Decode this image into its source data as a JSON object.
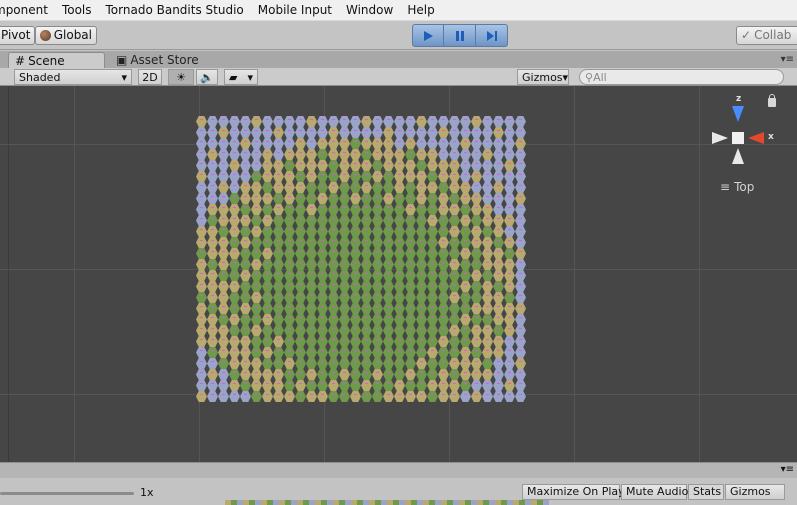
{
  "menu": [
    "mponent",
    "Tools",
    "Tornado Bandits Studio",
    "Mobile Input",
    "Window",
    "Help"
  ],
  "toolbar": {
    "pivot": "Pivot",
    "global": "Global",
    "collab": "Collab",
    "play_controls": [
      "play-icon",
      "pause-icon",
      "step-icon"
    ]
  },
  "tabs": {
    "scene": "Scene",
    "asset_store": "Asset Store"
  },
  "scene_toolbar": {
    "shading": "Shaded",
    "mode_2d": "2D",
    "gizmos": "Gizmos",
    "search_placeholder": "All"
  },
  "scene_gizmo": {
    "z_label": "z",
    "x_label": "x",
    "view": "Top"
  },
  "game_view": {
    "scale": "1x",
    "buttons": [
      "Maximize On Play",
      "Mute Audio",
      "Stats",
      "Gizmos"
    ]
  },
  "colors": {
    "terrain_green": "#6f9a4b",
    "terrain_sand": "#b8a96f",
    "terrain_water": "#9aa3c8",
    "marker": "#e54ee5",
    "axis_x": "#e24a2c",
    "axis_z": "#4a8bff"
  },
  "hex_map": {
    "rows": 26,
    "cols": 30,
    "legend": [
      "grass",
      "sand",
      "water"
    ]
  }
}
